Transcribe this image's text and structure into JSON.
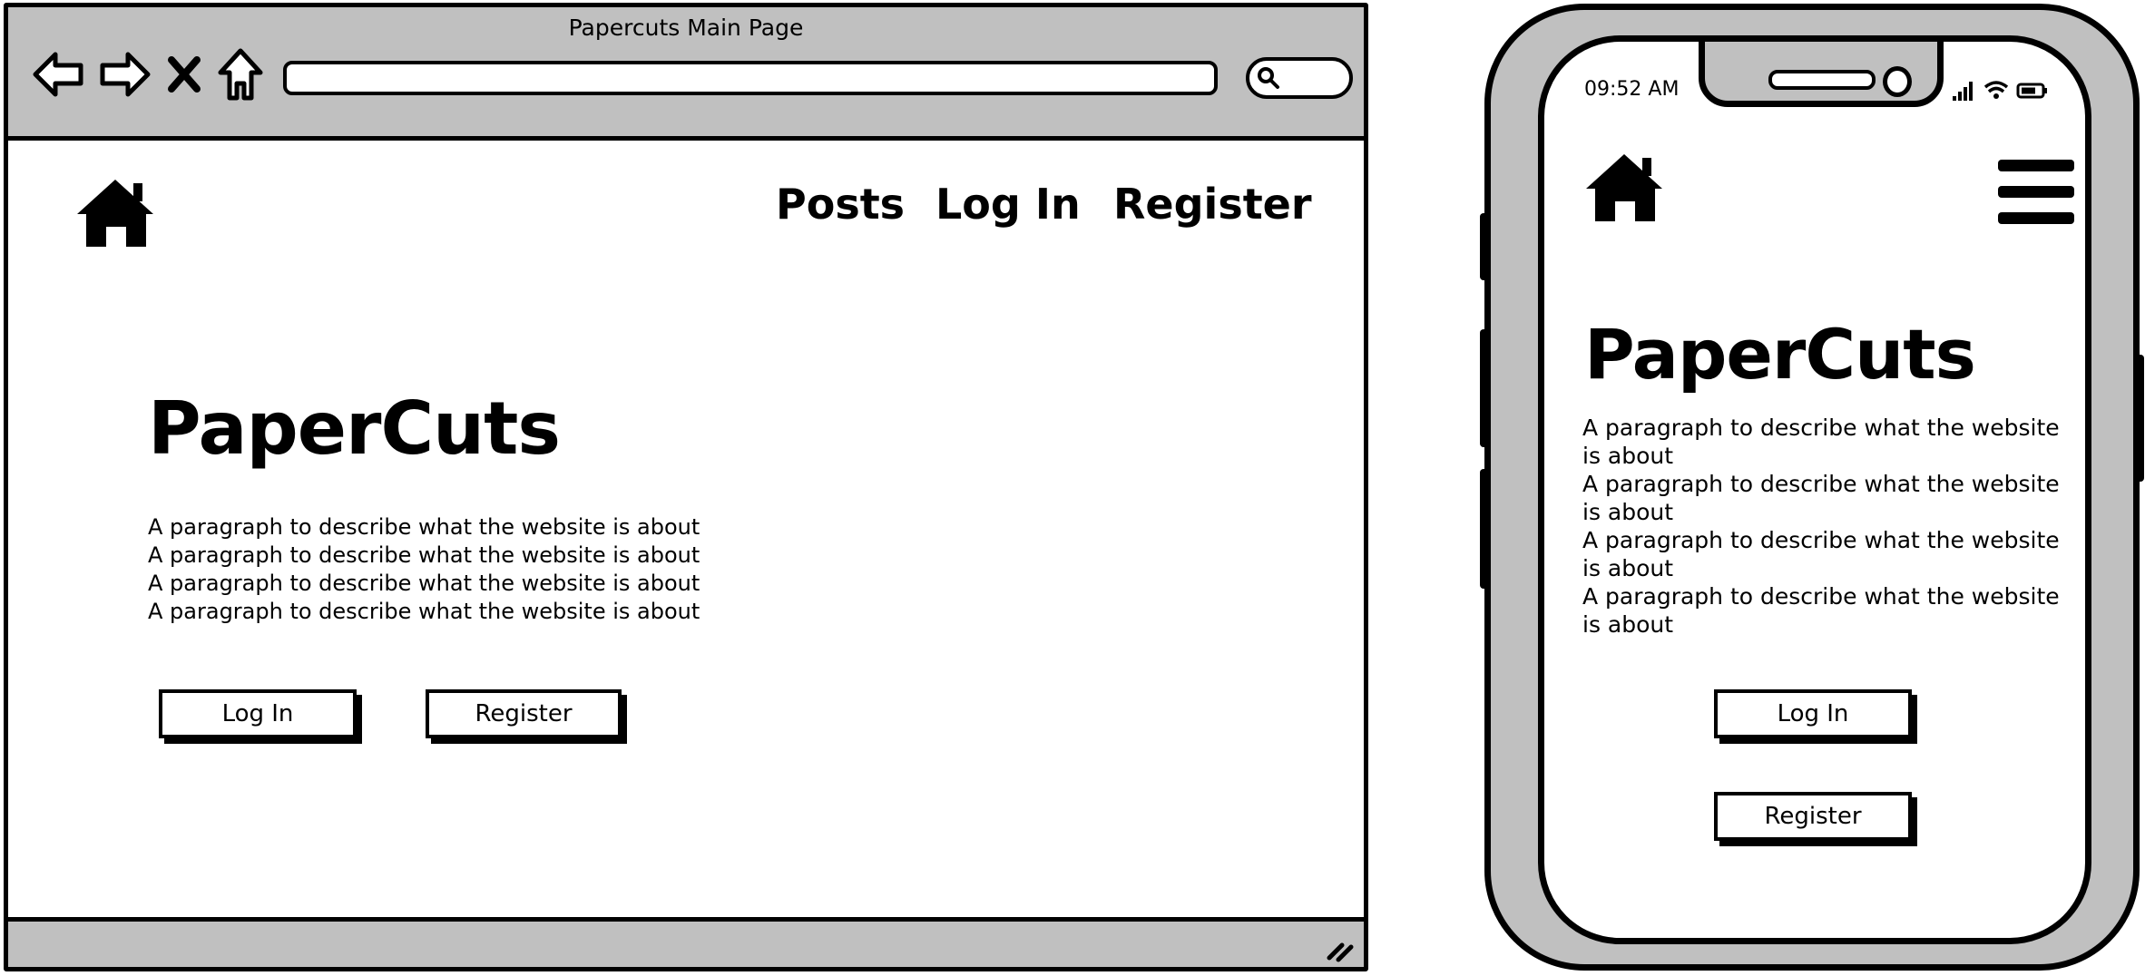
{
  "desktop": {
    "window_title": "Papercuts Main Page",
    "nav": {
      "posts": "Posts",
      "login": "Log In",
      "register": "Register"
    },
    "hero": {
      "title": "PaperCuts",
      "paragraphs": [
        "A paragraph to describe what the website is about",
        "A paragraph to describe what the website is about",
        "A paragraph to describe what the website is about",
        "A paragraph to describe what the website is about"
      ]
    },
    "buttons": {
      "login": "Log In",
      "register": "Register"
    },
    "url_value": ""
  },
  "mobile": {
    "status_time": "09:52 AM",
    "hero": {
      "title": "PaperCuts",
      "paragraphs": [
        "A paragraph to describe what the website is about",
        "A paragraph to describe what the website is about",
        "A paragraph to describe what the website is about",
        "A paragraph to describe what the website is about"
      ]
    },
    "buttons": {
      "login": "Log In",
      "register": "Register"
    }
  },
  "icons": [
    "back-arrow-icon",
    "forward-arrow-icon",
    "close-icon",
    "home-icon",
    "search-icon",
    "hamburger-menu-icon",
    "signal-icon",
    "wifi-icon",
    "battery-icon",
    "resize-grip-icon"
  ],
  "colors": {
    "chrome": "#c0c0c0",
    "stroke": "#000000",
    "background": "#ffffff"
  }
}
